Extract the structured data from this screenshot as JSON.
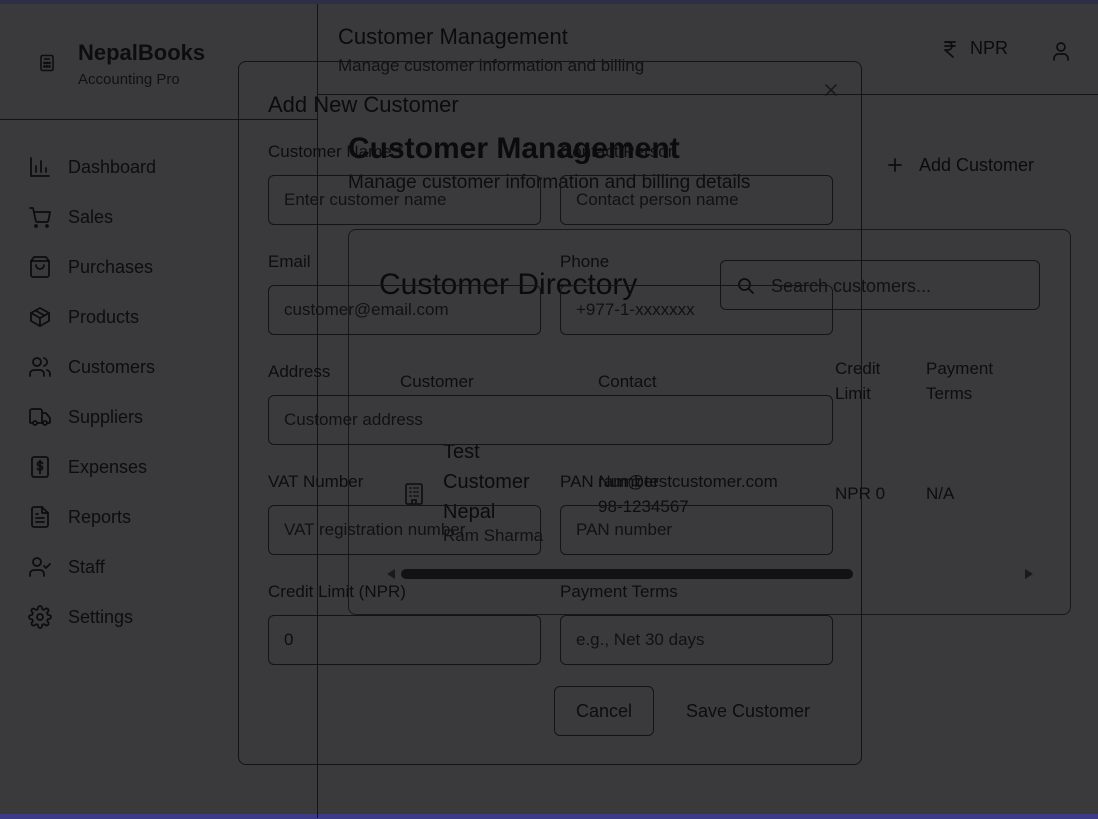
{
  "brand": {
    "name": "NepalBooks",
    "subtitle": "Accounting Pro"
  },
  "sidebar": {
    "items": [
      {
        "label": "Dashboard",
        "icon": "bar-chart-icon"
      },
      {
        "label": "Sales",
        "icon": "cart-icon"
      },
      {
        "label": "Purchases",
        "icon": "shopping-bag-icon"
      },
      {
        "label": "Products",
        "icon": "package-icon"
      },
      {
        "label": "Customers",
        "icon": "users-icon"
      },
      {
        "label": "Suppliers",
        "icon": "truck-icon"
      },
      {
        "label": "Expenses",
        "icon": "dollar-receipt-icon"
      },
      {
        "label": "Reports",
        "icon": "document-icon"
      },
      {
        "label": "Staff",
        "icon": "user-check-icon"
      },
      {
        "label": "Settings",
        "icon": "gear-icon"
      }
    ]
  },
  "header": {
    "title": "Customer Management",
    "subtitle": "Manage customer information and billing",
    "currency": "NPR"
  },
  "main": {
    "title": "Customer Management",
    "subtitle": "Manage customer information and billing details",
    "add_button": "Add Customer",
    "directory": {
      "title": "Customer Directory",
      "search_placeholder": "Search customers...",
      "columns": {
        "customer": "Customer",
        "contact": "Contact",
        "credit_limit_1": "Credit",
        "credit_limit_2": "Limit",
        "payment_terms_1": "Payment",
        "payment_terms_2": "Terms"
      },
      "rows": [
        {
          "name": "Test Customer Nepal",
          "contact_person": "Ram Sharma",
          "email": "ram@testcustomer.com",
          "phone": "98-1234567",
          "credit_limit": "NPR 0",
          "payment_terms": "N/A"
        }
      ]
    }
  },
  "modal": {
    "title": "Add New Customer",
    "fields": {
      "customer_name": {
        "label": "Customer Name *",
        "placeholder": "Enter customer name"
      },
      "contact_person": {
        "label": "Contact Person",
        "placeholder": "Contact person name"
      },
      "email": {
        "label": "Email",
        "placeholder": "customer@email.com"
      },
      "phone": {
        "label": "Phone",
        "placeholder": "+977-1-xxxxxxx"
      },
      "address": {
        "label": "Address",
        "placeholder": "Customer address"
      },
      "vat_number": {
        "label": "VAT Number",
        "placeholder": "VAT registration number"
      },
      "pan_number": {
        "label": "PAN Number",
        "placeholder": "PAN number"
      },
      "credit_limit": {
        "label": "Credit Limit (NPR)",
        "value": "0"
      },
      "payment_terms": {
        "label": "Payment Terms",
        "placeholder": "e.g., Net 30 days"
      }
    },
    "cancel_label": "Cancel",
    "save_label": "Save Customer"
  }
}
